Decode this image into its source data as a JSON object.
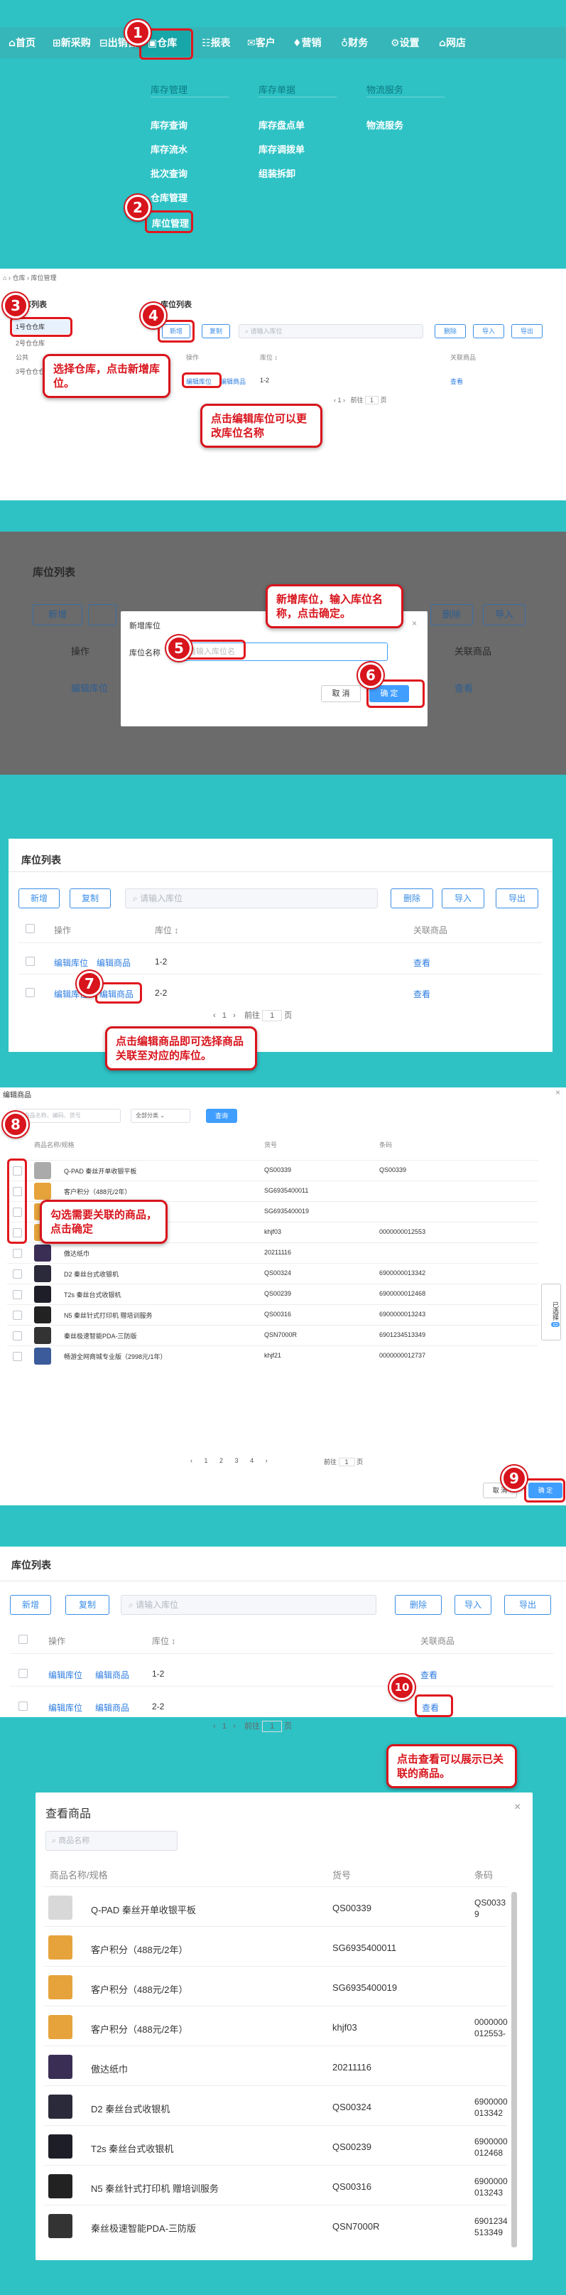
{
  "nav": {
    "items": [
      "首页",
      "新采购",
      "出销售",
      "仓库",
      "报表",
      "客户",
      "营销",
      "财务",
      "设置",
      "网店"
    ],
    "menu": {
      "col1": {
        "head": "库存管理",
        "items": [
          "库存查询",
          "库存流水",
          "批次查询",
          "仓库管理",
          "库位管理"
        ]
      },
      "col2": {
        "head": "库存单据",
        "items": [
          "库存盘点单",
          "库存调拨单",
          "组装拆卸"
        ]
      },
      "col3": {
        "head": "物流服务",
        "items": [
          "物流服务"
        ]
      }
    }
  },
  "s2": {
    "breadcrumb": [
      "仓库",
      "库位管理"
    ],
    "left_title": "仓库列表",
    "left_items": [
      "1号仓仓库",
      "2号仓仓库",
      "公共",
      "3号仓仓仓"
    ],
    "title": "库位列表",
    "add": "新增",
    "copy": "复制",
    "search_ph": "请输入库位",
    "del": "删除",
    "import": "导入",
    "export": "导出",
    "h_op": "操作",
    "h_loc": "库位 ↕",
    "h_rel": "关联商品",
    "row_edit": "编辑库位",
    "row_goods": "编辑商品",
    "row_loc": "1-2",
    "row_view": "查看",
    "pager_goto": "前往",
    "pager_page": "1",
    "pager_unit": "页",
    "call1": "选择仓库，点击新增库位。",
    "call2": "点击编辑库位可以更改库位名称"
  },
  "s3": {
    "title": "库位列表",
    "add": "新增",
    "copy": "复制",
    "del": "删除",
    "import": "导入",
    "h_op": "操作",
    "h_rel": "关联商品",
    "row_edit": "编辑库位",
    "row_view": "查看",
    "dlg_title": "新增库位",
    "dlg_label": "库位名称",
    "dlg_ph": "请输入库位名",
    "cancel": "取 消",
    "ok": "确 定",
    "call": "新增库位，输入库位名称，点击确定。"
  },
  "s4": {
    "title": "库位列表",
    "add": "新增",
    "copy": "复制",
    "search_ph": "请输入库位",
    "del": "删除",
    "import": "导入",
    "export": "导出",
    "h_op": "操作",
    "h_loc": "库位 ↕",
    "h_rel": "关联商品",
    "rows": [
      {
        "edit": "编辑库位",
        "goods": "编辑商品",
        "loc": "1-2",
        "view": "查看"
      },
      {
        "edit": "编辑库位",
        "goods": "编辑商品",
        "loc": "2-2",
        "view": "查看"
      }
    ],
    "pager_page": "1",
    "pager_goto": "前往",
    "pager_unit": "页",
    "call": "点击编辑商品即可选择商品关联至对应的库位。"
  },
  "s5": {
    "title": "编辑商品",
    "search_ph": "商品名称、编码、货号",
    "cat": "全部分类",
    "query": "查询",
    "h_name": "商品名称/规格",
    "h_code": "货号",
    "h_bar": "条码",
    "rows": [
      {
        "name": "Q-PAD 秦丝开单收银平板",
        "code": "QS00339",
        "bar": "QS00339"
      },
      {
        "name": "客户积分（488元/2年）",
        "code": "SG6935400011",
        "bar": ""
      },
      {
        "name": "客户积分（488元/2年）",
        "code": "SG6935400019",
        "bar": ""
      },
      {
        "name": "客户积分（488元/2年）",
        "code": "khjf03",
        "bar": "0000000012553"
      },
      {
        "name": "傲达纸巾",
        "code": "20211116",
        "bar": ""
      },
      {
        "name": "D2 秦丝台式收银机",
        "code": "QS00324",
        "bar": "6900000013342"
      },
      {
        "name": "T2s 秦丝台式收银机",
        "code": "QS00239",
        "bar": "6900000012468"
      },
      {
        "name": "N5 秦丝针式打印机 赠培训服务",
        "code": "QS00316",
        "bar": "6900000013243"
      },
      {
        "name": "秦丝极速智能PDA-三防版",
        "code": "QSN7000R",
        "bar": "6901234513349"
      },
      {
        "name": "畅游全网商城专业版（2998元/1年）",
        "code": "khjf21",
        "bar": "0000000012737"
      }
    ],
    "pages": [
      "1",
      "2",
      "3",
      "4"
    ],
    "pager_goto": "前往",
    "pager_page": "1",
    "pager_unit": "页",
    "selected_tab": "已选择",
    "selected_count": "0",
    "cancel": "取 消",
    "ok": "确 定",
    "call": "勾选需要关联的商品，点击确定"
  },
  "s6": {
    "title": "库位列表",
    "add": "新增",
    "copy": "复制",
    "search_ph": "请输入库位",
    "del": "删除",
    "import": "导入",
    "export": "导出",
    "h_op": "操作",
    "h_loc": "库位 ↕",
    "h_rel": "关联商品",
    "rows": [
      {
        "edit": "编辑库位",
        "goods": "编辑商品",
        "loc": "1-2",
        "view": "查看"
      },
      {
        "edit": "编辑库位",
        "goods": "编辑商品",
        "loc": "2-2",
        "view": "查看"
      }
    ],
    "pager_page": "1",
    "pager_goto": "前往",
    "pager_unit": "页",
    "call": "点击查看可以展示已关联的商品。"
  },
  "s7": {
    "title": "查看商品",
    "search_ph": "商品名称",
    "h_name": "商品名称/规格",
    "h_code": "货号",
    "h_bar": "条码",
    "rows": [
      {
        "name": "Q-PAD 秦丝开单收银平板",
        "code": "QS00339",
        "bar": "QS00339"
      },
      {
        "name": "客户积分（488元/2年）",
        "code": "SG6935400011",
        "bar": ""
      },
      {
        "name": "客户积分（488元/2年）",
        "code": "SG6935400019",
        "bar": ""
      },
      {
        "name": "客户积分（488元/2年）",
        "code": "khjf03",
        "bar": "0000000012553-"
      },
      {
        "name": "傲达纸巾",
        "code": "20211116",
        "bar": ""
      },
      {
        "name": "D2 秦丝台式收银机",
        "code": "QS00324",
        "bar": "6900000013342"
      },
      {
        "name": "T2s 秦丝台式收银机",
        "code": "QS00239",
        "bar": "6900000012468"
      },
      {
        "name": "N5 秦丝针式打印机 赠培训服务",
        "code": "QS00316",
        "bar": "6900000013243"
      },
      {
        "name": "秦丝极速智能PDA-三防版",
        "code": "QSN7000R",
        "bar": "6901234513349"
      }
    ]
  },
  "colors": {
    "teal": "#2cc4c4",
    "nav": "#3bb8b8",
    "red": "#d8141c",
    "blue": "#409eff"
  }
}
